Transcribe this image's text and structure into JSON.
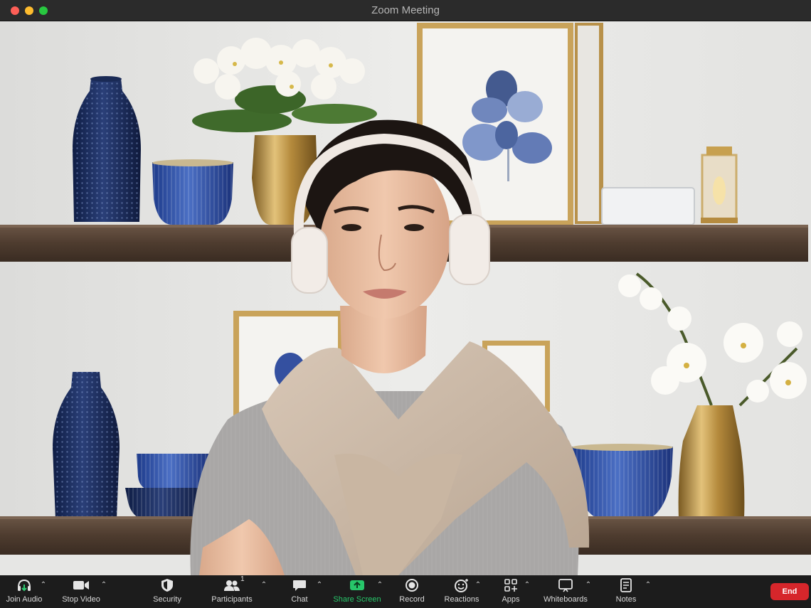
{
  "window": {
    "title": "Zoom Meeting"
  },
  "toolbar": {
    "join_audio": "Join Audio",
    "stop_video": "Stop Video",
    "security": "Security",
    "participants": "Participants",
    "participants_count": "1",
    "chat": "Chat",
    "share_screen": "Share Screen",
    "record": "Record",
    "reactions": "Reactions",
    "apps": "Apps",
    "whiteboards": "Whiteboards",
    "notes": "Notes",
    "end": "End"
  },
  "colors": {
    "share_screen_accent": "#27c66a",
    "end_button": "#d6262b",
    "toolbar_bg": "#1c1c1c",
    "titlebar_bg": "#2b2b2b"
  }
}
